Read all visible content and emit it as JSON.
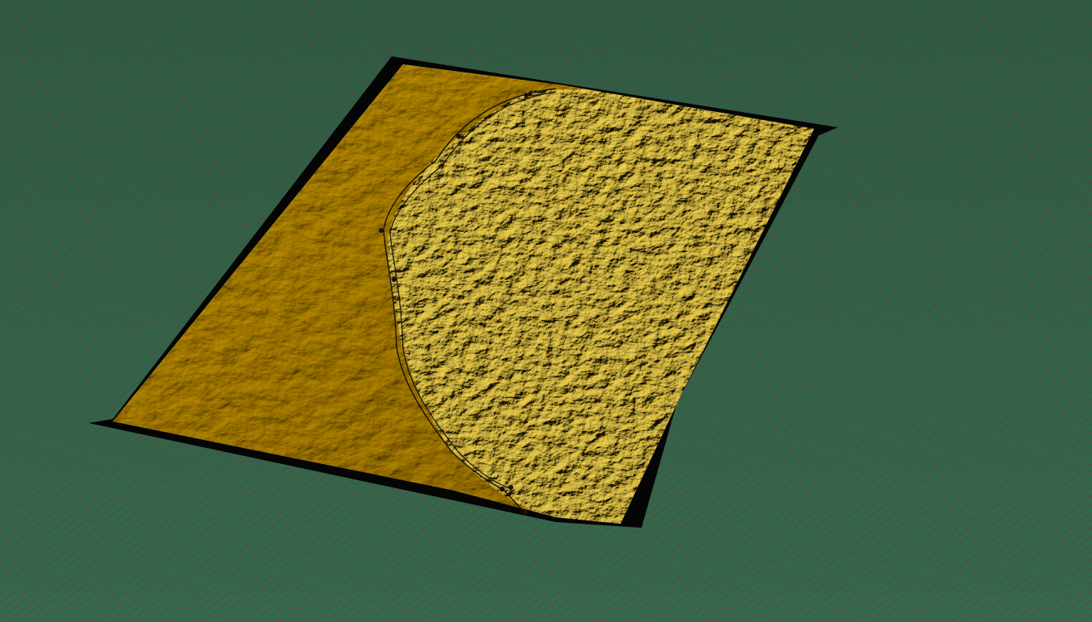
{
  "viewport": {
    "mode": "3d-perspective-view",
    "shading": "textured-relief",
    "grid_visible": true
  },
  "colors": {
    "ground": "#2f6148",
    "ground_light": "#3a6c52",
    "grid_line": "#7a2a2a",
    "terrain_base": "#c9a90a",
    "terrain_light": "#f0d24a",
    "terrain_dark": "#7f6a00",
    "skirt": "#050505",
    "survey_line": "#141008"
  },
  "survey_line": {
    "vertex_count": 8,
    "visible": true
  }
}
